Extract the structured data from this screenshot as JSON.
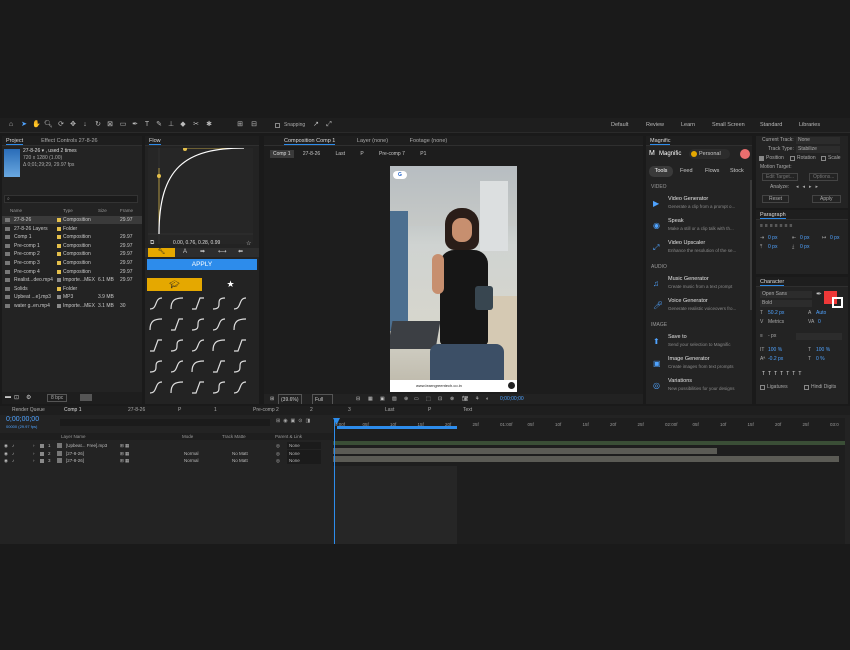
{
  "workspaces": [
    "Default",
    "Review",
    "Learn",
    "Small Screen",
    "Standard",
    "Libraries"
  ],
  "toolbar": {
    "snapping": "Snapping"
  },
  "project": {
    "tab": "Project",
    "tab2": "Effect Controls 27-8-26",
    "item_name": "27-8-26 ▾ , used 2 times",
    "item_size": "720 x 1280 (1.00)",
    "item_dur": "Δ 0;01;29;29, 29.97 fps",
    "search": "",
    "cols": [
      "Name",
      "Type",
      "Size",
      "Frame Ra..."
    ],
    "rows": [
      {
        "name": "27-8-26",
        "type": "Composition",
        "size": "",
        "fr": "29.97",
        "color": "#e5c04b"
      },
      {
        "name": "27-8-26 Layers",
        "type": "Folder",
        "size": "",
        "fr": "",
        "color": "#e5c04b"
      },
      {
        "name": "Comp 1",
        "type": "Composition",
        "size": "",
        "fr": "29.97",
        "color": "#e5c04b"
      },
      {
        "name": "Pre-comp 1",
        "type": "Composition",
        "size": "",
        "fr": "29.97",
        "color": "#e5c04b"
      },
      {
        "name": "Pre-comp 2",
        "type": "Composition",
        "size": "",
        "fr": "29.97",
        "color": "#e5c04b"
      },
      {
        "name": "Pre-comp 3",
        "type": "Composition",
        "size": "",
        "fr": "29.97",
        "color": "#e5c04b"
      },
      {
        "name": "Pre-comp 4",
        "type": "Composition",
        "size": "",
        "fr": "29.97",
        "color": "#e5c04b"
      },
      {
        "name": "Realist...deo.mp4",
        "type": "Importe...MEX",
        "size": "6.1 MB",
        "fr": "29.97",
        "color": "#8a8a8a"
      },
      {
        "name": "Solids",
        "type": "Folder",
        "size": "",
        "fr": "",
        "color": "#e5c04b"
      },
      {
        "name": "Upbeat ...e].mp3",
        "type": "MP3",
        "size": "3.9 MB",
        "fr": "",
        "color": "#8a8a8a"
      },
      {
        "name": "water g..en.mp4",
        "type": "Importe...MEX",
        "size": "3.1 MB",
        "fr": "30",
        "color": "#8a8a8a"
      }
    ],
    "bpc": "8 bpc"
  },
  "flow": {
    "tab": "Flow",
    "values": "0.00, 0.76, 0.28, 0.99",
    "apply": "APPLY"
  },
  "comp": {
    "tab": "Composition Comp 1",
    "layer_tab": "Layer (none)",
    "footage_tab": "Footage (none)",
    "breadcrumbs": [
      "Comp 1",
      "27-8-26",
      "Last",
      "P",
      "Pre-comp 7",
      "P1"
    ],
    "zoom": "(39.6%)",
    "quality": "Full",
    "timecode": "0;00;00;00",
    "video_url": "www.learngreentech.co.in"
  },
  "magnific": {
    "title": "Magnific",
    "brand": "Magnific",
    "plan": "Personal",
    "tabs": [
      "Tools",
      "Feed",
      "Flows",
      "Stock"
    ],
    "sections": {
      "video": "VIDEO",
      "audio": "AUDIO",
      "image": "IMAGE"
    },
    "video_tools": [
      {
        "title": "Video Generator",
        "desc": "Generate a clip from a prompt o..."
      },
      {
        "title": "Speak",
        "desc": "Make a still or a clip talk with th..."
      },
      {
        "title": "Video Upscaler",
        "desc": "Enhance the resolution of the se..."
      }
    ],
    "audio_tools": [
      {
        "title": "Music Generator",
        "desc": "Create music from a text prompt"
      },
      {
        "title": "Voice Generator",
        "desc": "Generate realistic voiceovers fro..."
      }
    ],
    "image_tools": [
      {
        "title": "Save to",
        "desc": "Send your selection to Magnific"
      },
      {
        "title": "Image Generator",
        "desc": "Create images from text prompts"
      },
      {
        "title": "Variations",
        "desc": "New possibilities for your designs"
      }
    ]
  },
  "tracker": {
    "current_track": "Current Track:",
    "current_track_val": "None",
    "track_type": "Track Type:",
    "track_type_val": "Stabilize",
    "position": "Position",
    "rotation": "Rotation",
    "scale": "Scale",
    "motion_target": "Motion Target:",
    "edit_target": "Edit Target...",
    "options": "Options...",
    "analyze": "Analyze:",
    "reset": "Reset",
    "apply": "Apply"
  },
  "paragraph": {
    "title": "Paragraph",
    "vals": [
      "0 px",
      "0 px",
      "0 px",
      "0 px",
      "0 px"
    ]
  },
  "character": {
    "title": "Character",
    "font": "Open Sans",
    "style": "Bold",
    "size": "50.2 px",
    "leading": "Auto",
    "kerning": "Metrics",
    "tracking": "0",
    "stroke": "- px",
    "vscale": "100 %",
    "hscale": "100 %",
    "baseline": "-0.2 px",
    "tsume": "0 %",
    "ligatures": "Ligatures",
    "hindi": "Hindi Digits"
  },
  "timeline": {
    "tabs": [
      "Render Queue",
      "Comp 1",
      "27-8-26",
      "P",
      "1",
      "Pre-comp 2",
      "2",
      "3",
      "Last",
      "P",
      "Text"
    ],
    "timecode": "0;00;00;00",
    "sub": "00000 (29.97 fps)",
    "cols": {
      "layer_name": "Layer Name",
      "mode": "Mode",
      "track_matte": "Track Matte",
      "parent": "Parent & Link"
    },
    "layers": [
      {
        "num": "1",
        "name": "[Upbeat... Free].mp3",
        "mode": "",
        "matte": "",
        "parent": "None"
      },
      {
        "num": "2",
        "name": "[27-8-26]",
        "mode": "Normal",
        "matte": "No Matt",
        "parent": "None"
      },
      {
        "num": "3",
        "name": "[27-8-26]",
        "mode": "Normal",
        "matte": "No Matt",
        "parent": "None"
      }
    ],
    "ruler": [
      "0:00f",
      "05f",
      "10f",
      "15f",
      "20f",
      "25f",
      "01:00f",
      "05f",
      "10f",
      "15f",
      "20f",
      "25f",
      "02:00f",
      "05f",
      "10f",
      "15f",
      "20f",
      "25f",
      "03:0"
    ]
  }
}
